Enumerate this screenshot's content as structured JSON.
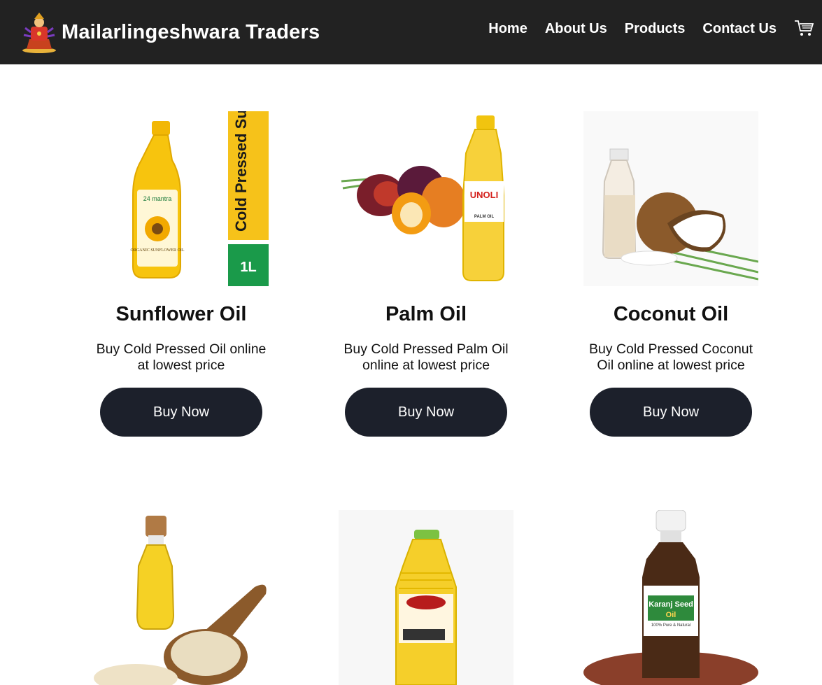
{
  "header": {
    "brand": "Mailarlingeshwara Traders",
    "nav": [
      "Home",
      "About Us",
      "Products",
      "Contact Us"
    ],
    "cart_icon": "cart-icon"
  },
  "products": [
    {
      "title": "Sunflower Oil",
      "desc": "Buy Cold Pressed Oil online at lowest price",
      "button": "Buy Now",
      "label_text": "Cold Pressed Sunflower Oil",
      "size_text": "1L",
      "bottle_text": "ORGANIC SUNFLOWER OIL",
      "brand_text": "24 mantra"
    },
    {
      "title": "Palm Oil",
      "desc": "Buy Cold Pressed Palm Oil online at lowest price",
      "button": "Buy Now",
      "bottle_text": "UNOLI",
      "bottle_sub": "PALM OIL"
    },
    {
      "title": "Coconut Oil",
      "desc": "Buy Cold Pressed Coconut Oil online at lowest price",
      "button": "Buy Now"
    },
    {
      "title": "",
      "desc": "",
      "button": ""
    },
    {
      "title": "",
      "desc": "",
      "button": ""
    },
    {
      "title": "",
      "desc": "",
      "button": "",
      "bottle_text": "Karanj Seed",
      "bottle_sub": "Oil",
      "bottle_small": "100% Pure & Natural"
    }
  ],
  "colors": {
    "navbar": "#222222",
    "button": "#1c202b",
    "label_yellow": "#f6c21a",
    "label_green": "#1a9a4a"
  }
}
